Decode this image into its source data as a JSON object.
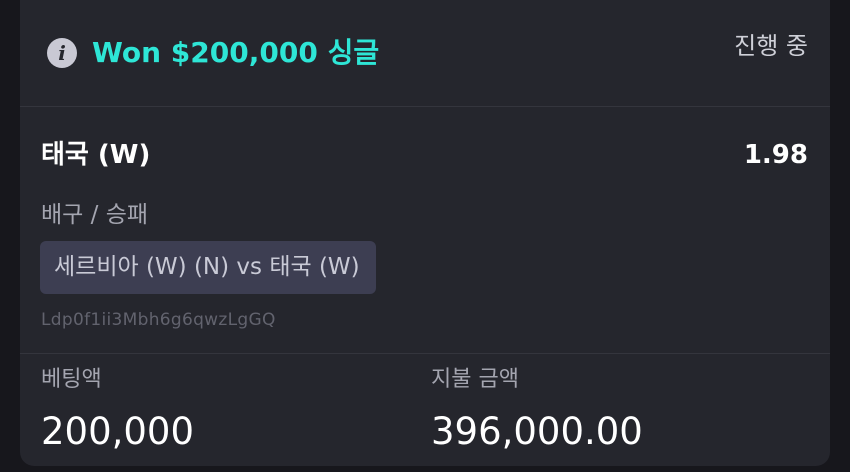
{
  "header": {
    "title": "Won $200,000 싱글",
    "status": "진행 중",
    "info_icon": "info-icon",
    "title_color": "#2ee6d6"
  },
  "bet": {
    "selection": "태국 (W)",
    "odds": "1.98",
    "market": "배구 / 승패",
    "event": "세르비아 (W) (N) vs 태국 (W)",
    "bet_id": "Ldp0f1ii3Mbh6g6qwzLgGQ"
  },
  "amounts": {
    "stake_label": "베팅액",
    "stake_value": "200,000",
    "payout_label": "지불 금액",
    "payout_value": "396,000.00"
  }
}
